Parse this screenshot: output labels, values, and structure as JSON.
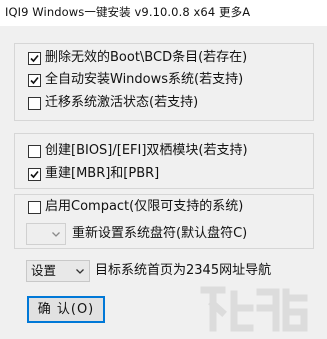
{
  "window": {
    "title": "IQI9 Windows一键安装 v9.10.0.8 x64 更多A"
  },
  "group_boot": {
    "items": [
      {
        "label": "删除无效的Boot\\BCD条目(若存在)",
        "checked": true
      },
      {
        "label": "全自动安装Windows系统(若支持)",
        "checked": true
      },
      {
        "label": "迁移系统激活状态(若支持)",
        "checked": false
      }
    ]
  },
  "group_mbr": {
    "items": [
      {
        "label": "创建[BIOS]/[EFI]双栖模块(若支持)",
        "checked": false
      },
      {
        "label": "重建[MBR]和[PBR]",
        "checked": true
      }
    ]
  },
  "group_compact": {
    "compact_label": "启用Compact(仅限可支持的系统)",
    "compact_checked": false,
    "drive_combo_value": "",
    "drive_label": "重新设置系统盘符(默认盘符C)"
  },
  "homepage": {
    "combo_value": "设置",
    "label": "目标系统首页为2345网址导航"
  },
  "confirm_button": {
    "label": "确 认(O)"
  },
  "colors": {
    "accent": "#0078d7",
    "watermark": "#dcdcdc"
  }
}
